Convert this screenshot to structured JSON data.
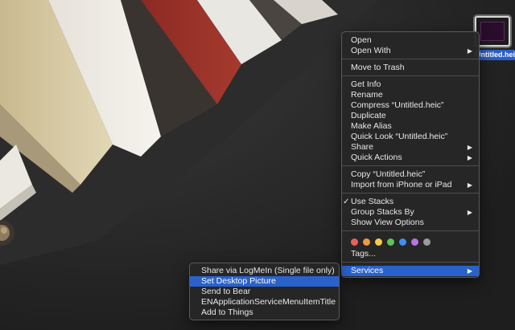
{
  "desktop": {
    "file": {
      "name": "Untitled.heic",
      "icon": "heic-thumbnail-icon"
    }
  },
  "context_menu": {
    "groups": [
      {
        "items": [
          {
            "label": "Open"
          },
          {
            "label": "Open With",
            "submenu": true
          }
        ]
      },
      {
        "items": [
          {
            "label": "Move to Trash"
          }
        ]
      },
      {
        "items": [
          {
            "label": "Get Info"
          },
          {
            "label": "Rename"
          },
          {
            "label": "Compress “Untitled.heic”"
          },
          {
            "label": "Duplicate"
          },
          {
            "label": "Make Alias"
          },
          {
            "label": "Quick Look “Untitled.heic”"
          },
          {
            "label": "Share",
            "submenu": true
          },
          {
            "label": "Quick Actions",
            "submenu": true
          }
        ]
      },
      {
        "items": [
          {
            "label": "Copy “Untitled.heic”"
          },
          {
            "label": "Import from iPhone or iPad",
            "submenu": true
          }
        ]
      },
      {
        "items": [
          {
            "label": "Use Stacks",
            "checked": true
          },
          {
            "label": "Group Stacks By",
            "submenu": true
          },
          {
            "label": "Show View Options"
          }
        ]
      },
      {
        "tag_colors": [
          "#ec5f5d",
          "#f19a3d",
          "#f5cd43",
          "#5fc452",
          "#3f8ef5",
          "#b975dc",
          "#9b9b9b"
        ],
        "items": [
          {
            "label": "Tags..."
          }
        ]
      },
      {
        "items": [
          {
            "label": "Services",
            "submenu": true,
            "highlighted": true
          }
        ]
      }
    ],
    "check_glyph": "✓",
    "arrow_glyph": "▶"
  },
  "services_submenu": {
    "items": [
      {
        "label": "Share via LogMeIn (Single file only)"
      },
      {
        "label": "Set Desktop Picture",
        "highlighted": true
      },
      {
        "label": "Send to Bear"
      },
      {
        "label": "ENApplicationServiceMenuItemTitle"
      },
      {
        "label": "Add to Things"
      }
    ]
  },
  "colors": {
    "highlight": "#2a62cc",
    "menu_bg": "#262628"
  }
}
